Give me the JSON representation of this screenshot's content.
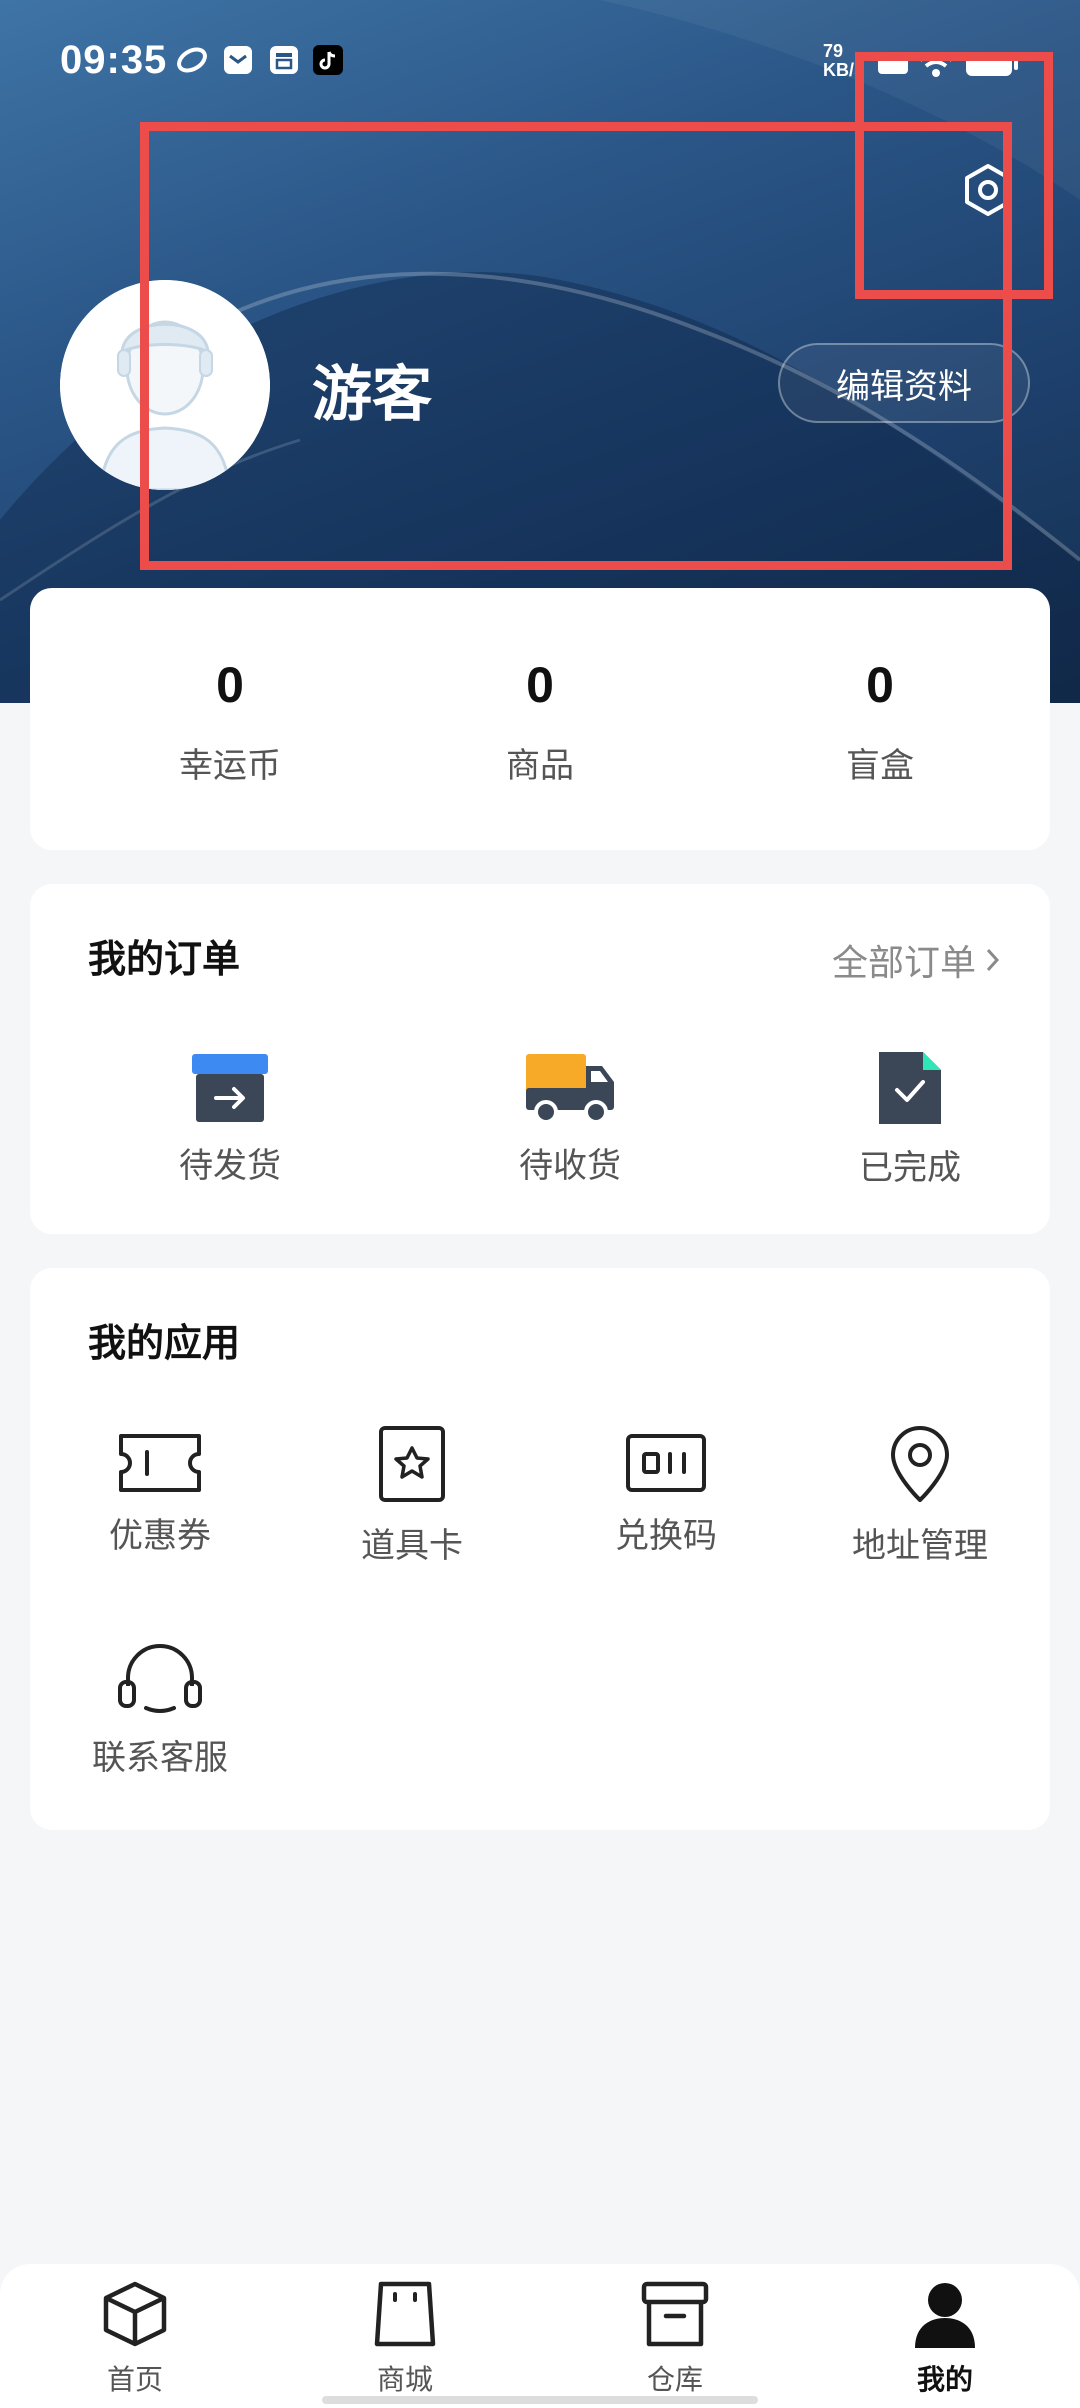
{
  "status_bar": {
    "time": "09:35",
    "net_speed_value": "79",
    "net_speed_unit": "KB/s",
    "app_icons": [
      "vpn-icon",
      "mail-icon",
      "store-icon",
      "tiktok-icon"
    ]
  },
  "profile": {
    "username": "游客",
    "edit_label": "编辑资料"
  },
  "stats": [
    {
      "value": "0",
      "label": "幸运币"
    },
    {
      "value": "0",
      "label": "商品"
    },
    {
      "value": "0",
      "label": "盲盒"
    }
  ],
  "orders": {
    "title": "我的订单",
    "all_label": "全部订单",
    "items": [
      {
        "label": "待发货",
        "icon": "to-ship-icon"
      },
      {
        "label": "待收货",
        "icon": "truck-icon"
      },
      {
        "label": "已完成",
        "icon": "completed-doc-icon"
      }
    ]
  },
  "apps": {
    "title": "我的应用",
    "items": [
      {
        "label": "优惠券",
        "icon": "coupon-icon"
      },
      {
        "label": "道具卡",
        "icon": "star-card-icon"
      },
      {
        "label": "兑换码",
        "icon": "redeem-code-icon"
      },
      {
        "label": "地址管理",
        "icon": "location-pin-icon"
      },
      {
        "label": "联系客服",
        "icon": "headset-icon"
      }
    ]
  },
  "tabbar": {
    "active": "我的",
    "items": [
      {
        "label": "首页",
        "icon": "cube-icon"
      },
      {
        "label": "商城",
        "icon": "shopping-bag-icon"
      },
      {
        "label": "仓库",
        "icon": "archive-box-icon"
      },
      {
        "label": "我的",
        "icon": "user-icon"
      }
    ]
  },
  "colors": {
    "hero_top": "#3f74a6",
    "hero_bottom": "#15304f",
    "annotation": "#ec4d4a",
    "accent_blue": "#3d8bf2",
    "accent_orange": "#f7a928",
    "accent_teal": "#2ee6b6",
    "icon_dark": "#3b4656"
  }
}
